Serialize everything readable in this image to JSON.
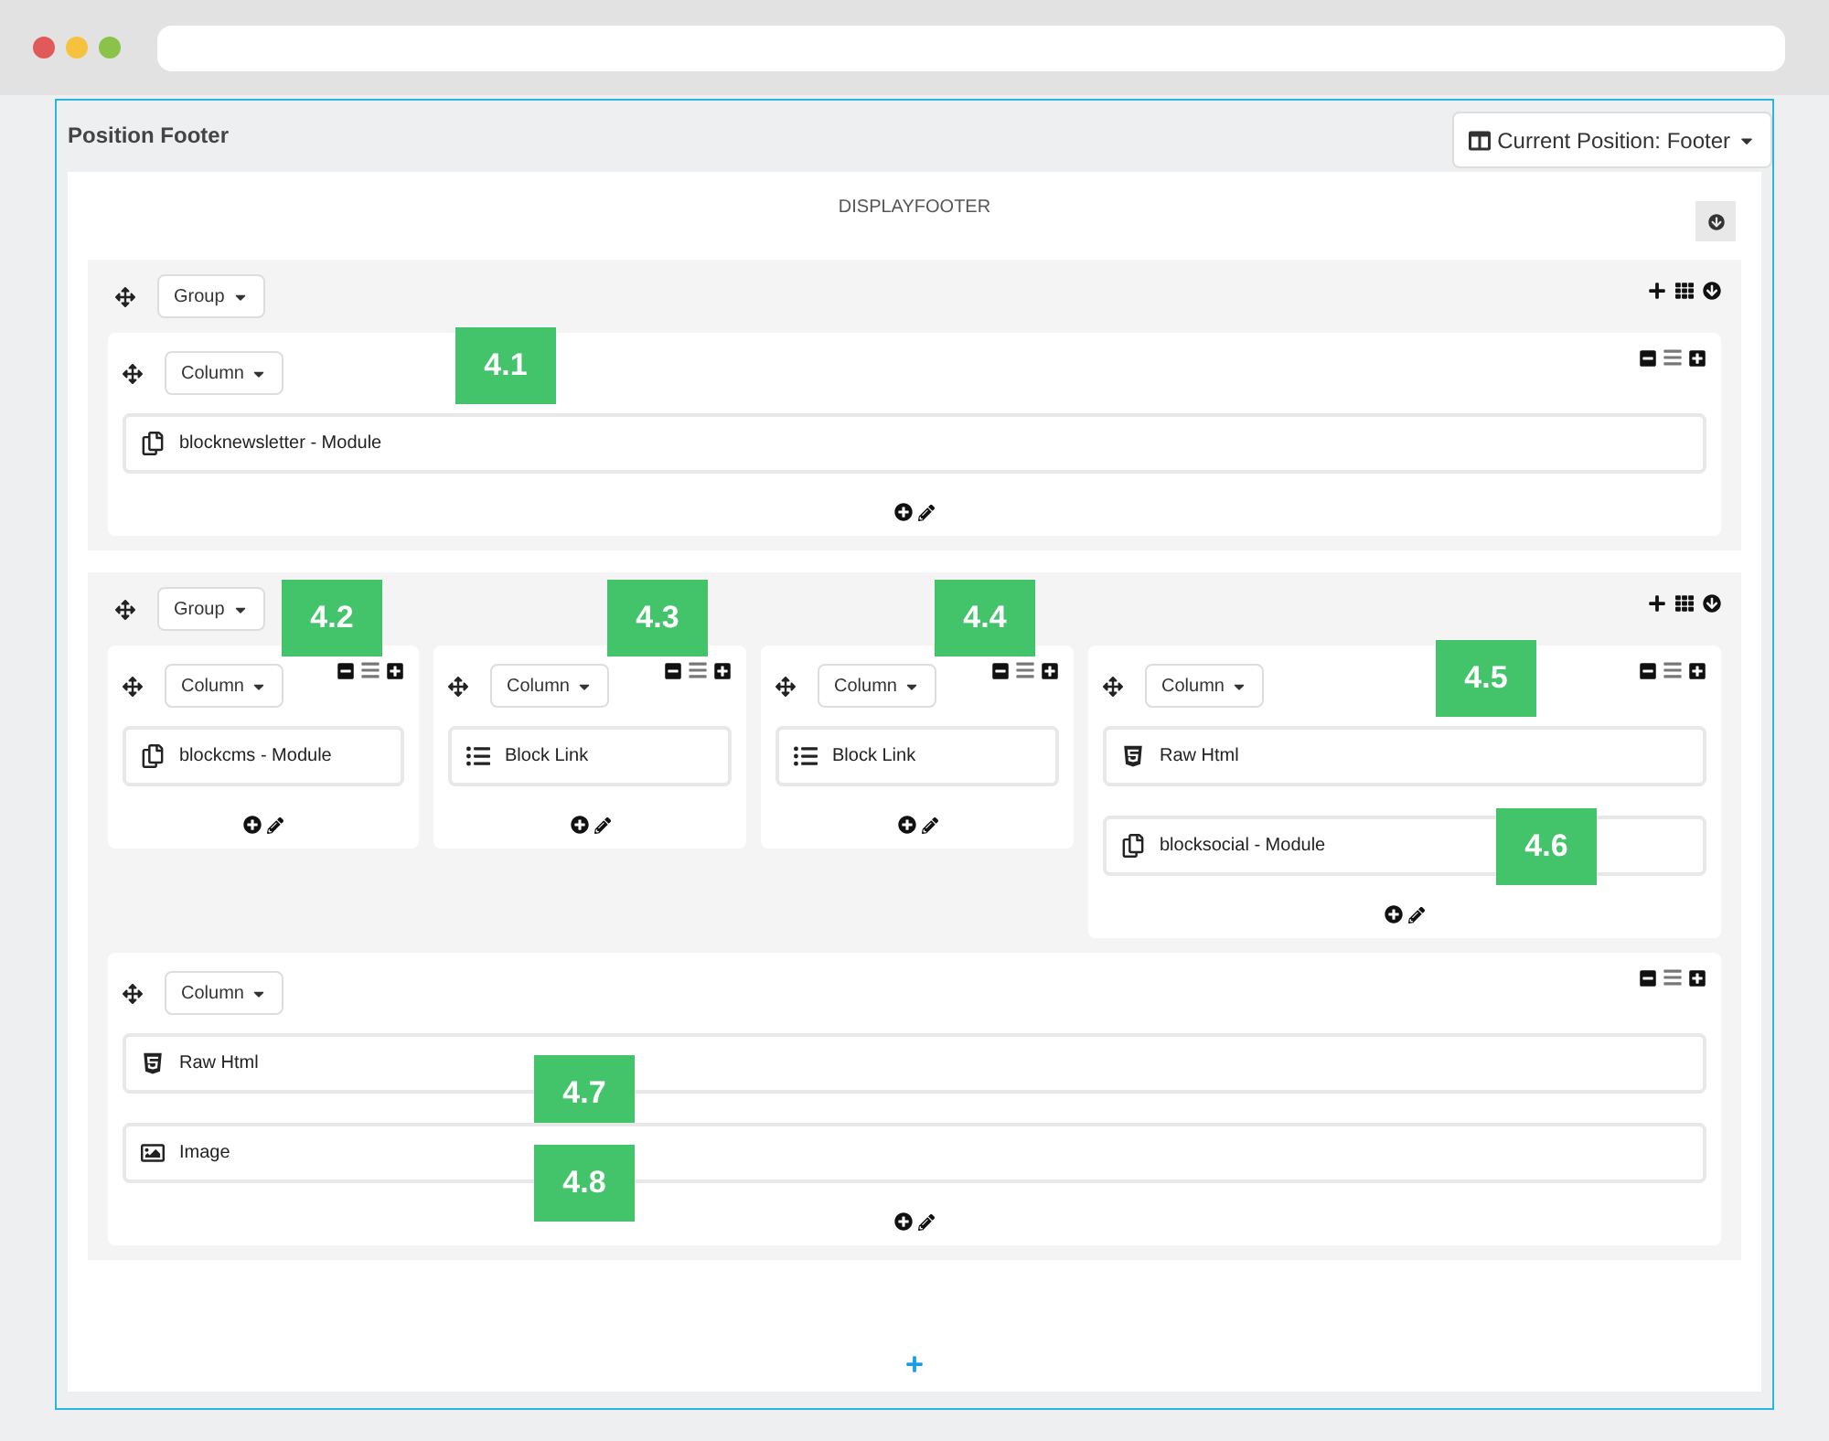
{
  "panel": {
    "title": "Position Footer",
    "position_button": "Current Position: Footer"
  },
  "hook": {
    "title": "DISPLAYFOOTER"
  },
  "groups": [
    {
      "label": "Group",
      "columns": [
        {
          "label": "Column",
          "badge": "4.1",
          "items": [
            {
              "kind": "module",
              "label": "blocknewsletter - Module"
            }
          ]
        }
      ]
    },
    {
      "label": "Group",
      "columns": [
        {
          "label": "Column",
          "badge": "4.2",
          "items": [
            {
              "kind": "module",
              "label": "blockcms - Module"
            }
          ]
        },
        {
          "label": "Column",
          "badge": "4.3",
          "items": [
            {
              "kind": "links",
              "label": "Block Link"
            }
          ]
        },
        {
          "label": "Column",
          "badge": "4.4",
          "items": [
            {
              "kind": "links",
              "label": "Block Link"
            }
          ]
        },
        {
          "label": "Column",
          "badge": "4.5",
          "items": [
            {
              "kind": "html",
              "label": "Raw Html"
            },
            {
              "kind": "module",
              "label": "blocksocial - Module",
              "badge": "4.6"
            }
          ]
        },
        {
          "label": "Column",
          "items": [
            {
              "kind": "html",
              "label": "Raw Html",
              "badge": "4.7"
            },
            {
              "kind": "image",
              "label": "Image",
              "badge": "4.8"
            }
          ]
        }
      ]
    }
  ]
}
